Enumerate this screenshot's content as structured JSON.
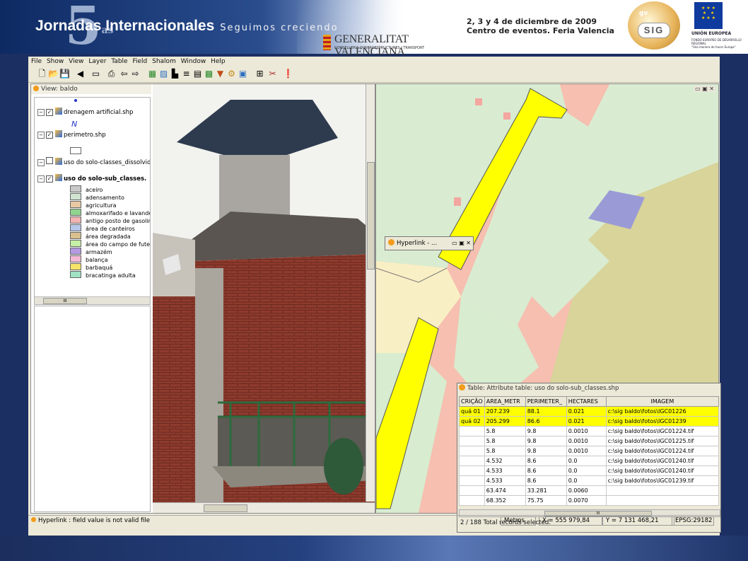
{
  "banner": {
    "five": "5",
    "five_sup": "as",
    "title": "Jornadas Internacionales",
    "subtitle": "Seguimos creciendo",
    "gv_name": "GENERALITAT VALENCIANA",
    "gv_dept": "CONSELLERIA D'INFRAESTRUCTURES I TRANSPORT",
    "event_line1": "2, 3 y 4 de diciembre de 2009",
    "event_line2": "Centro de eventos. Feria Valencia",
    "gvsig_small": "gv",
    "gvsig_big": "SIG",
    "eu_title": "UNIÓN EUROPEA",
    "eu_sub": "FONDO EUROPEO DE DESARROLLO REGIONAL",
    "eu_tagline": "\"Una manera de hacer Europa\""
  },
  "menu": [
    "File",
    "Show",
    "View",
    "Layer",
    "Table",
    "Field",
    "Shalom",
    "Window",
    "Help"
  ],
  "view": {
    "title": "View: baldo",
    "layers": [
      {
        "name": "drenagem artificial.shp",
        "checked": true
      },
      {
        "name": "perimetro.shp",
        "checked": true
      },
      {
        "name": "uso do solo-classes_dissolvido.",
        "checked": false
      },
      {
        "name": "uso do solo-sub_classes.",
        "checked": true
      }
    ],
    "legend": [
      {
        "label": "aceiro",
        "color": "#c9c9c9"
      },
      {
        "label": "adensamento",
        "color": "#cfe3d0"
      },
      {
        "label": "agricultura",
        "color": "#e8c9a4"
      },
      {
        "label": "almoxarifado e lavanderia",
        "color": "#8fd38f"
      },
      {
        "label": "antigo posto de gasolina",
        "color": "#f3b3b3"
      },
      {
        "label": "área de canteiros",
        "color": "#b6c7ea"
      },
      {
        "label": "área degradada",
        "color": "#d9c08e"
      },
      {
        "label": "área do campo de futebol",
        "color": "#c5f0a6"
      },
      {
        "label": "armazém",
        "color": "#b49ae0"
      },
      {
        "label": "balança",
        "color": "#f3b9d6"
      },
      {
        "label": "barbaquá",
        "color": "#f5e36a"
      },
      {
        "label": "bracatinga adulta",
        "color": "#9fe2c4"
      }
    ]
  },
  "hyperlink_title": "Hyperlink - ...",
  "table": {
    "title": "Table: Attribute table: uso do solo-sub_classes.shp",
    "columns": [
      "CRIÇÃO",
      "AREA_METR",
      "PERIMETER_",
      "HECTARES",
      "IMAGEM"
    ],
    "rows": [
      {
        "selected": true,
        "cells": [
          "quá 01",
          "207.239",
          "88.1",
          "0.021",
          "c:\\sig baldo\\fotos\\IGC01226"
        ]
      },
      {
        "selected": true,
        "cells": [
          "quá 02",
          "205.299",
          "86.6",
          "0.021",
          "c:\\sig baldo\\fotos\\IGC01239"
        ]
      },
      {
        "selected": false,
        "cells": [
          "",
          "5.8",
          "9.8",
          "0.0010",
          "c:\\sig baldo\\fotos\\IGC01224.tif"
        ]
      },
      {
        "selected": false,
        "cells": [
          "",
          "5.8",
          "9.8",
          "0.0010",
          "c:\\sig baldo\\fotos\\IGC01225.tif"
        ]
      },
      {
        "selected": false,
        "cells": [
          "",
          "5.8",
          "9.8",
          "0.0010",
          "c:\\sig baldo\\fotos\\IGC01224.tif"
        ]
      },
      {
        "selected": false,
        "cells": [
          "",
          "4.532",
          "8.6",
          "0.0",
          "c:\\sig baldo\\fotos\\IGC01240.tif"
        ]
      },
      {
        "selected": false,
        "cells": [
          "",
          "4.533",
          "8.6",
          "0.0",
          "c:\\sig baldo\\fotos\\IGC01240.tif"
        ]
      },
      {
        "selected": false,
        "cells": [
          "",
          "4.533",
          "8.6",
          "0.0",
          "c:\\sig baldo\\fotos\\IGC01239.tif"
        ]
      },
      {
        "selected": false,
        "cells": [
          "",
          "63.474",
          "33.281",
          "0.0060",
          ""
        ]
      },
      {
        "selected": false,
        "cells": [
          "",
          "68.352",
          "75.75",
          "0.0070",
          ""
        ]
      }
    ],
    "status": "2 / 188 Total records selected."
  },
  "status": {
    "message": "Hyperlink : field value is not valid file",
    "units": "Metros",
    "x": "X = 555 979,84",
    "y": "Y = 7 131 468,21",
    "epsg": "EPSG:29182"
  },
  "colors": {
    "accent_orange": "#f39b1b",
    "selection": "#ffff00",
    "window_bg": "#ece9d8"
  }
}
